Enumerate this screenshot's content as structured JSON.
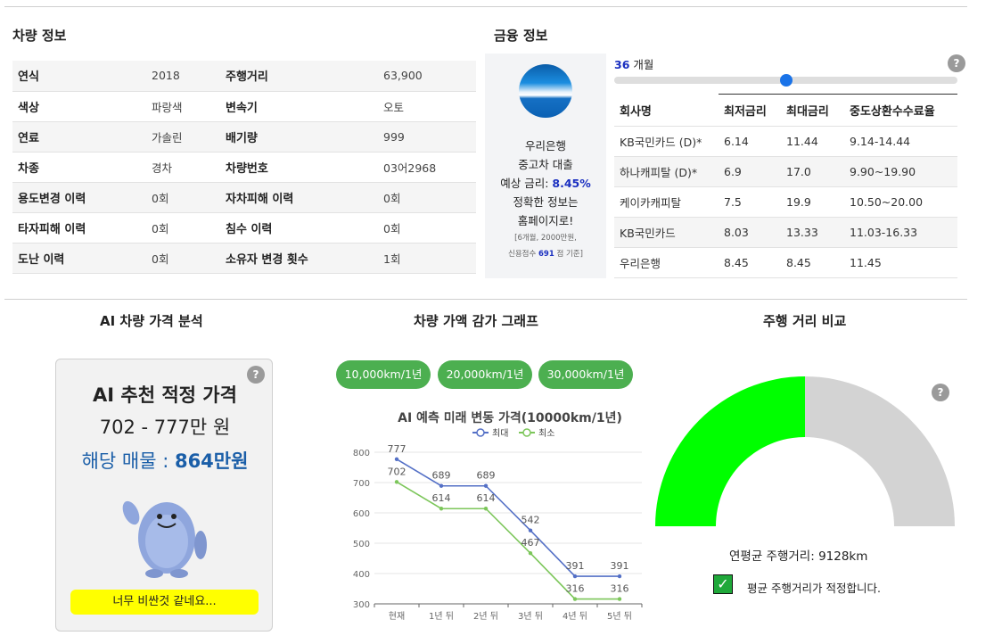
{
  "vehicle": {
    "title": "차량 정보",
    "rows": [
      {
        "k1": "연식",
        "v1": "2018",
        "k2": "주행거리",
        "v2": "63,900"
      },
      {
        "k1": "색상",
        "v1": "파랑색",
        "k2": "변속기",
        "v2": "오토"
      },
      {
        "k1": "연료",
        "v1": "가솔린",
        "k2": "배기량",
        "v2": "999"
      },
      {
        "k1": "차종",
        "v1": "경차",
        "k2": "차량번호",
        "v2": "03어2968"
      },
      {
        "k1": "용도변경 이력",
        "v1": "0회",
        "k2": "자차피해 이력",
        "v2": "0회"
      },
      {
        "k1": "타자피해 이력",
        "v1": "0회",
        "k2": "침수 이력",
        "v2": "0회"
      },
      {
        "k1": "도난 이력",
        "v1": "0회",
        "k2": "소유자 변경 횟수",
        "v2": "1회"
      }
    ]
  },
  "finance": {
    "title": "금융 정보",
    "bank": {
      "name": "우리은행",
      "loan": "중고차 대출",
      "rate_prefix": "예상 금리: ",
      "rate": "8.45%",
      "accurate": "정확한 정보는",
      "homepage": "홈페이지로!",
      "note1": "[6개월, 2000만원,",
      "note2_pre": "신용점수 ",
      "note2_score": "691",
      "note2_post": " 점 기준]"
    },
    "months_value": "36",
    "months_unit": " 개월",
    "slider_fraction": 0.5,
    "help": "?",
    "headers": [
      "회사명",
      "최저금리",
      "최대금리",
      "중도상환수수료율"
    ],
    "rows": [
      [
        "KB국민카드 (D)*",
        "6.14",
        "11.44",
        "9.14-14.44"
      ],
      [
        "하나캐피탈 (D)*",
        "6.9",
        "17.0",
        "9.90~19.90"
      ],
      [
        "케이카캐피탈",
        "7.5",
        "19.9",
        "10.50~20.00"
      ],
      [
        "KB국민카드",
        "8.03",
        "13.33",
        "11.03-16.33"
      ],
      [
        "우리은행",
        "8.45",
        "8.45",
        "11.45"
      ]
    ]
  },
  "ai": {
    "title": "AI 차량 가격 분석",
    "box_title": "AI 추천 적정 가격",
    "range": "702 - 777만 원",
    "price_prefix": "해당 매물 : ",
    "price": "864만원",
    "button": "너무 비싼것 같네요...",
    "help": "?"
  },
  "depreciation": {
    "title": "차량 가액 감가 그래프",
    "buttons": [
      "10,000km/1년",
      "20,000km/1년",
      "30,000km/1년"
    ]
  },
  "chart_data": {
    "type": "line",
    "title": "AI 예측 미래 변동 가격(10000km/1년)",
    "categories": [
      "현재",
      "1년 뒤",
      "2년 뒤",
      "3년 뒤",
      "4년 뒤",
      "5년 뒤"
    ],
    "series": [
      {
        "name": "최대",
        "values": [
          777,
          689,
          689,
          542,
          391,
          391
        ],
        "color": "#5470c6"
      },
      {
        "name": "최소",
        "values": [
          702,
          614,
          614,
          467,
          316,
          316
        ],
        "color": "#7cc65a"
      }
    ],
    "yticks": [
      300,
      400,
      500,
      600,
      700,
      800
    ],
    "ylim": [
      300,
      800
    ],
    "legend": "top-center",
    "grid": true
  },
  "mileage": {
    "title": "주행 거리 비교",
    "help": "?",
    "gauge_fraction": 0.5,
    "gauge_color": "#00ff00",
    "gauge_bg": "#d3d3d3",
    "avg_text": "연평균 주행거리: 9128km",
    "check_text": "평균 주행거리가 적정합니다."
  }
}
